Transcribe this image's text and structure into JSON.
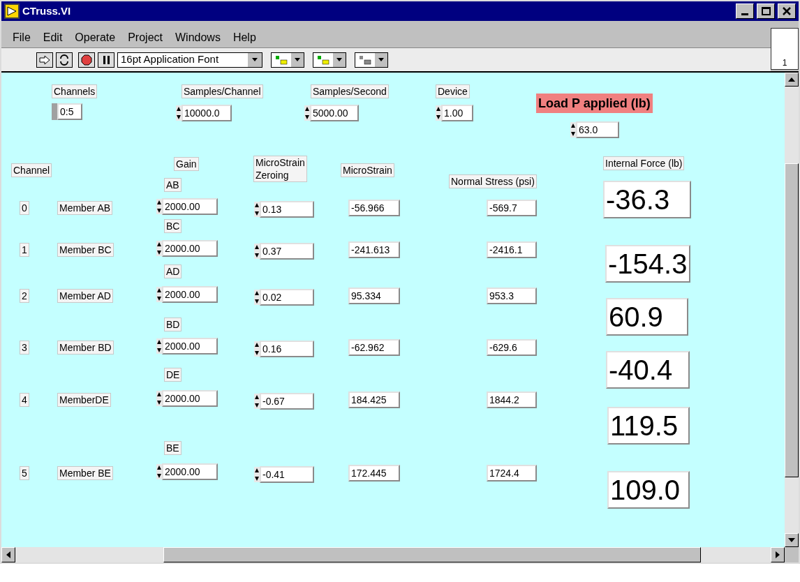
{
  "window": {
    "title": "CTruss.VI"
  },
  "menu": [
    "File",
    "Edit",
    "Operate",
    "Project",
    "Windows",
    "Help"
  ],
  "toolbar": {
    "font": "16pt Application Font"
  },
  "vi_icon": {
    "label": "1"
  },
  "top_controls": [
    {
      "kind": "channels",
      "label": "Channels",
      "value": "0:5"
    },
    {
      "kind": "numeric",
      "label": "Samples/Channel",
      "value": "10000.0"
    },
    {
      "kind": "numeric",
      "label": "Samples/Second",
      "value": "5000.00"
    },
    {
      "kind": "numeric",
      "label": "Device",
      "value": "1.00"
    }
  ],
  "load": {
    "label": "Load P applied (lb)",
    "value": "63.0"
  },
  "headers": {
    "channel": "Channel",
    "gain": "Gain",
    "zeroing": "MicroStrain\nZeroing",
    "microstrain": "MicroStrain",
    "stress": "Normal Stress (psi)",
    "force": "Internal Force (lb)"
  },
  "rows": [
    {
      "gain_label": "AB",
      "index": "0",
      "member": "Member AB",
      "gain": "2000.00",
      "zeroing": "0.13",
      "microstrain": "-56.966",
      "stress": "-569.7",
      "force": "-36.3"
    },
    {
      "gain_label": "BC",
      "index": "1",
      "member": "Member BC",
      "gain": "2000.00",
      "zeroing": "0.37",
      "microstrain": "-241.613",
      "stress": "-2416.1",
      "force": "-154.3"
    },
    {
      "gain_label": "AD",
      "index": "2",
      "member": "Member AD",
      "gain": "2000.00",
      "zeroing": "0.02",
      "microstrain": "95.334",
      "stress": "953.3",
      "force": "60.9"
    },
    {
      "gain_label": "BD",
      "index": "3",
      "member": "Member BD",
      "gain": "2000.00",
      "zeroing": "0.16",
      "microstrain": "-62.962",
      "stress": "-629.6",
      "force": "-40.4"
    },
    {
      "gain_label": "DE",
      "index": "4",
      "member": "MemberDE",
      "gain": "2000.00",
      "zeroing": "-0.67",
      "microstrain": "184.425",
      "stress": "1844.2",
      "force": "119.5"
    },
    {
      "gain_label": "BE",
      "index": "5",
      "member": "Member BE",
      "gain": "2000.00",
      "zeroing": "-0.41",
      "microstrain": "172.445",
      "stress": "1724.4",
      "force": "109.0"
    }
  ]
}
